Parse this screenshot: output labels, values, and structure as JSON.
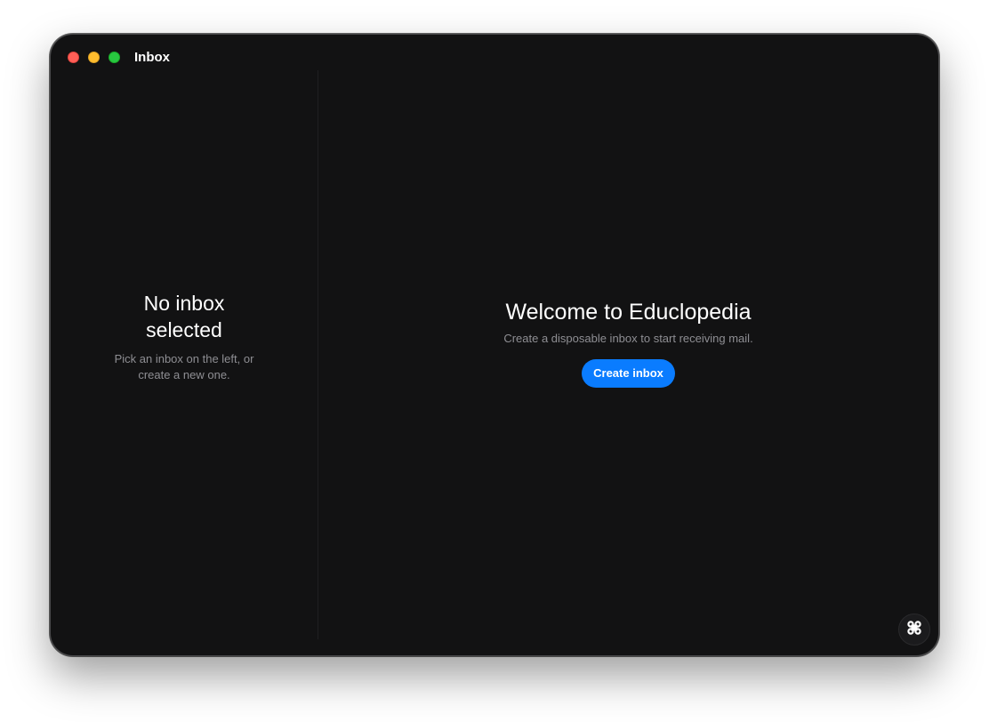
{
  "window": {
    "title": "Inbox"
  },
  "sidebar": {
    "empty_title": "No inbox selected",
    "empty_subtitle": "Pick an inbox on the left, or create a new one."
  },
  "main": {
    "welcome_title": "Welcome to Educlopedia",
    "welcome_subtitle": "Create a disposable inbox to start receiving mail.",
    "create_button_label": "Create inbox"
  },
  "icons": {
    "corner_button": "command-icon",
    "traffic_lights": [
      "close-icon",
      "minimize-icon",
      "zoom-icon"
    ]
  },
  "colors": {
    "window_background": "#121213",
    "accent": "#0a7cff",
    "secondary_text": "#8e8e93",
    "traffic_close": "#ff5f57",
    "traffic_minimize": "#febc2e",
    "traffic_zoom": "#28c840"
  }
}
